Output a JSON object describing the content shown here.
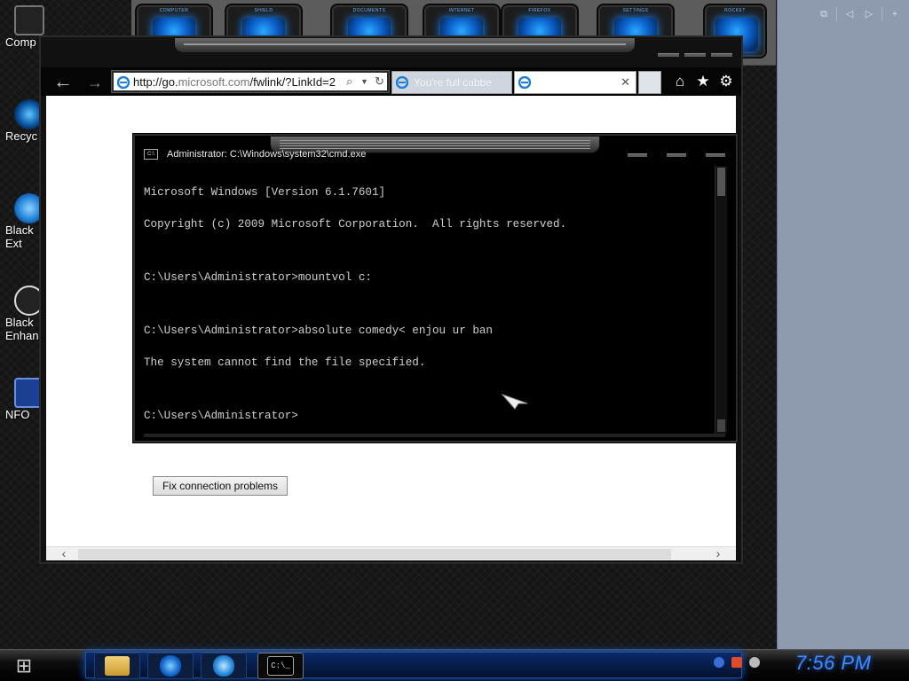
{
  "desktop": {
    "dock": [
      {
        "label": "COMPUTER",
        "icon": "computer-icon"
      },
      {
        "label": "SHIELD",
        "icon": "shield-icon"
      },
      {
        "label": "DOCUMENTS",
        "icon": "documents-icon"
      },
      {
        "label": "INTERNET",
        "icon": "internet-icon"
      },
      {
        "label": "FIREFOX",
        "icon": "firefox-icon"
      },
      {
        "label": "SETTINGS",
        "icon": "settings-icon"
      },
      {
        "label": "ROCKET",
        "icon": "rocket-icon"
      }
    ],
    "icons": [
      {
        "label": "Comp",
        "icon": "computer-icon"
      },
      {
        "label": "Recyc",
        "icon": "recycle-bin-icon"
      },
      {
        "label": "Black Ext",
        "icon": "internet-explorer-icon"
      },
      {
        "label": "Black Enhanc",
        "icon": "guitar-icon"
      },
      {
        "label": "NFO",
        "icon": "info-icon"
      }
    ]
  },
  "browser": {
    "url_prefix": "http://go.",
    "url_domain": "microsoft.com",
    "url_suffix": "/fwlink/?LinkId=2",
    "search_icon": "search-icon",
    "refresh_icon": "refresh-icon",
    "tabs": [
      {
        "title": "You're full cabbe",
        "icon": "internet-explorer-icon"
      },
      {
        "title": "",
        "icon": "internet-explorer-icon",
        "close": "✕"
      }
    ],
    "toolbar_icons": [
      "home-icon",
      "favorites-icon",
      "settings-icon"
    ],
    "fix_button": "Fix connection problems"
  },
  "cmd": {
    "title": "Administrator: C:\\Windows\\system32\\cmd.exe",
    "icon_text": "C:\\",
    "lines": [
      "Microsoft Windows [Version 6.1.7601]",
      "Copyright (c) 2009 Microsoft Corporation.  All rights reserved.",
      "",
      "C:\\Users\\Administrator>mountvol c:",
      "",
      "C:\\Users\\Administrator>absolute comedy< enjou ur ban",
      "The system cannot find the file specified.",
      "",
      "C:\\Users\\Administrator>"
    ]
  },
  "taskbar": {
    "buttons": [
      "explorer-folder-icon",
      "globe-icon",
      "internet-explorer-icon",
      "cmd-icon"
    ],
    "cmd_text": "C:\\_",
    "clock": "7:56 PM"
  },
  "colors": {
    "accent_blue": "#2aa9ff",
    "clock_blue": "#3f8cff",
    "right_panel": "#8d9ab0"
  }
}
